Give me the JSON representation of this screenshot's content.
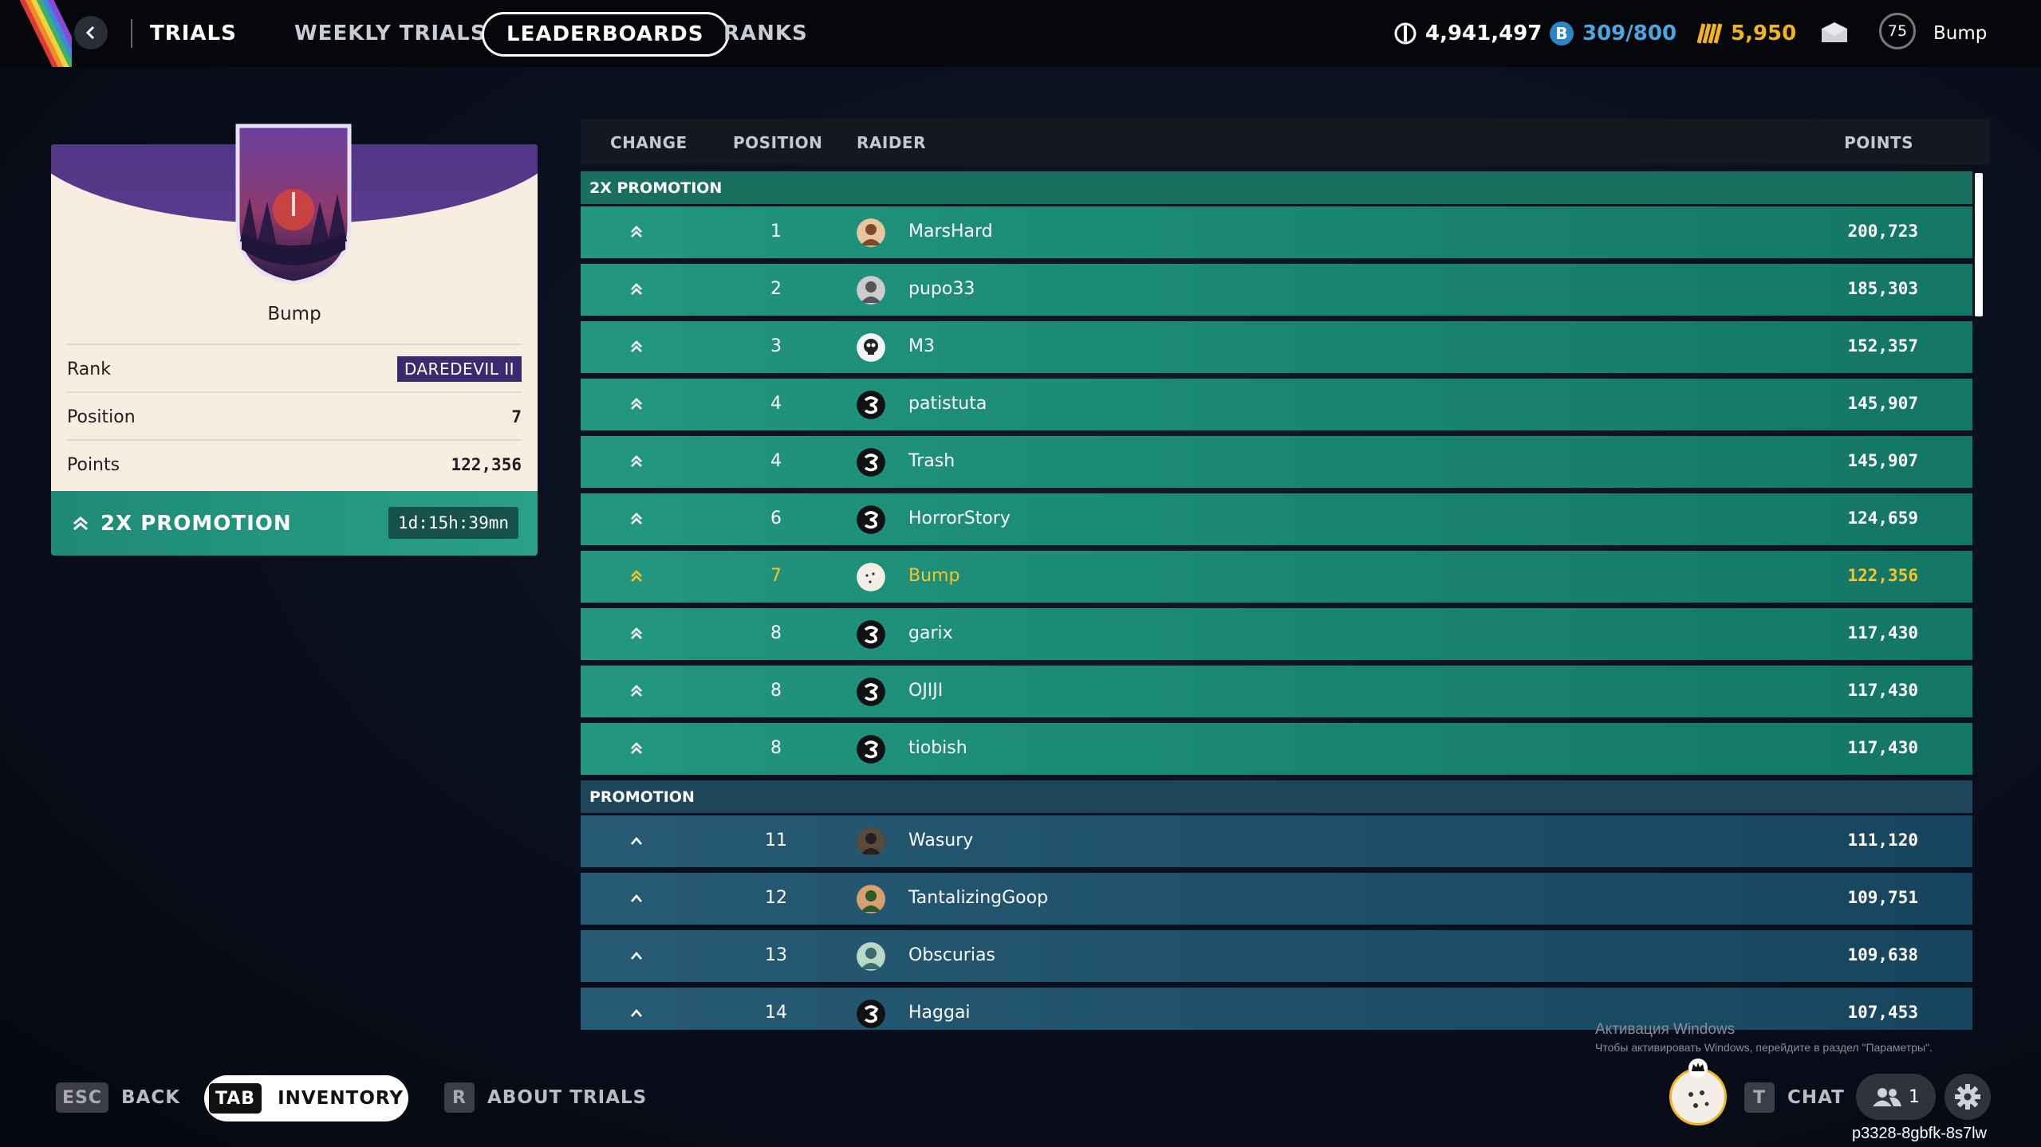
{
  "topbar": {
    "title": "TRIALS",
    "tabs": [
      "WEEKLY TRIALS",
      "LEADERBOARDS",
      "RANKS"
    ],
    "active_tab": "LEADERBOARDS",
    "currency_a": "4,941,497",
    "currency_b": "309/800",
    "currency_c": "5,950",
    "level": "75",
    "username": "Bump"
  },
  "card": {
    "name": "Bump",
    "rank_label": "Rank",
    "rank_value": "DAREDEVIL II",
    "position_label": "Position",
    "position_value": "7",
    "points_label": "Points",
    "points_value": "122,356",
    "promo_label": "2X PROMOTION",
    "timer": "1d:15h:39mn"
  },
  "board": {
    "headers": {
      "change": "CHANGE",
      "position": "POSITION",
      "raider": "RAIDER",
      "points": "POINTS"
    },
    "section_2x": "2X PROMOTION",
    "section_promo": "PROMOTION",
    "rows_2x": [
      {
        "pos": "1",
        "name": "MarsHard",
        "points": "200,723",
        "avatar": "photo-brown"
      },
      {
        "pos": "2",
        "name": "pupo33",
        "points": "185,303",
        "avatar": "photo-grey"
      },
      {
        "pos": "3",
        "name": "M3",
        "points": "152,357",
        "avatar": "skull"
      },
      {
        "pos": "4",
        "name": "patistuta",
        "points": "145,907",
        "avatar": "default"
      },
      {
        "pos": "4",
        "name": "Trash",
        "points": "145,907",
        "avatar": "default"
      },
      {
        "pos": "6",
        "name": "HorrorStory",
        "points": "124,659",
        "avatar": "default"
      },
      {
        "pos": "7",
        "name": "Bump",
        "points": "122,356",
        "avatar": "bump",
        "me": true
      },
      {
        "pos": "8",
        "name": "garix",
        "points": "117,430",
        "avatar": "default"
      },
      {
        "pos": "8",
        "name": "OJIJI",
        "points": "117,430",
        "avatar": "default"
      },
      {
        "pos": "8",
        "name": "tiobish",
        "points": "117,430",
        "avatar": "default"
      }
    ],
    "rows_promo": [
      {
        "pos": "11",
        "name": "Wasury",
        "points": "111,120",
        "avatar": "photo-dark"
      },
      {
        "pos": "12",
        "name": "TantalizingGoop",
        "points": "109,751",
        "avatar": "photo-green"
      },
      {
        "pos": "13",
        "name": "Obscurias",
        "points": "109,638",
        "avatar": "photo-teal"
      },
      {
        "pos": "14",
        "name": "Haggai",
        "points": "107,453",
        "avatar": "default"
      }
    ]
  },
  "bottom": {
    "esc_key": "ESC",
    "back_label": "BACK",
    "tab_key": "TAB",
    "inventory_label": "INVENTORY",
    "r_key": "R",
    "about_label": "ABOUT TRIALS",
    "t_key": "T",
    "chat_label": "CHAT",
    "friends_count": "1",
    "watermark_title": "Активация Windows",
    "watermark_sub": "Чтобы активировать Windows, перейдите в раздел \"Параметры\".",
    "session_id": "p3328-8gbfk-8s7lw"
  },
  "colors": {
    "accent_green": "#23977f",
    "accent_blue": "#275a74",
    "gold": "#f6c52a",
    "rank_purple": "#3b2a70"
  }
}
